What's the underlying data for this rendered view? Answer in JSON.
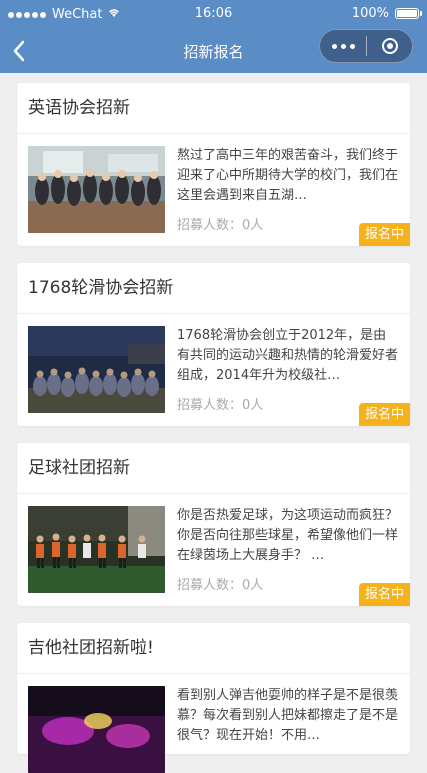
{
  "status_bar": {
    "carrier": "WeChat",
    "time": "16:06",
    "battery": "100%",
    "battery_level": 1.0,
    "signal_icon": "signal-dots-icon",
    "wifi_icon": "wifi-icon",
    "battery_icon": "battery-icon"
  },
  "nav": {
    "title": "招新报名",
    "back_icon": "back-arrow-icon",
    "more_icon": "more-dots-icon",
    "close_icon": "close-miniprogram-icon"
  },
  "colors": {
    "nav_bg": "#5a8cc5",
    "badge": "#f6b21b",
    "page_bg": "#efefef"
  },
  "cards": [
    {
      "title": "英语协会招新",
      "description": "熬过了高中三年的艰苦奋斗，我们终于迎来了心中所期待大学的校门，我们在这里会遇到来自五湖…",
      "count_label": "招募人数：0人",
      "status": "报名中"
    },
    {
      "title": "1768轮滑协会招新",
      "description": "1768轮滑协会创立于2012年，是由有共同的运动兴趣和热情的轮滑爱好者组成，2014年升为校级社…",
      "count_label": "招募人数：0人",
      "status": "报名中"
    },
    {
      "title": "足球社团招新",
      "description": "你是否热爱足球，为这项运动而疯狂？ 你是否向往那些球星，希望像他们一样在绿茵场上大展身手？ …",
      "count_label": "招募人数：0人",
      "status": "报名中"
    },
    {
      "title": "吉他社团招新啦!",
      "description": "看到别人弹吉他耍帅的样子是不是很羡慕？每次看到别人把妹都擦走了是不是很气？现在开始！不用…"
    }
  ]
}
